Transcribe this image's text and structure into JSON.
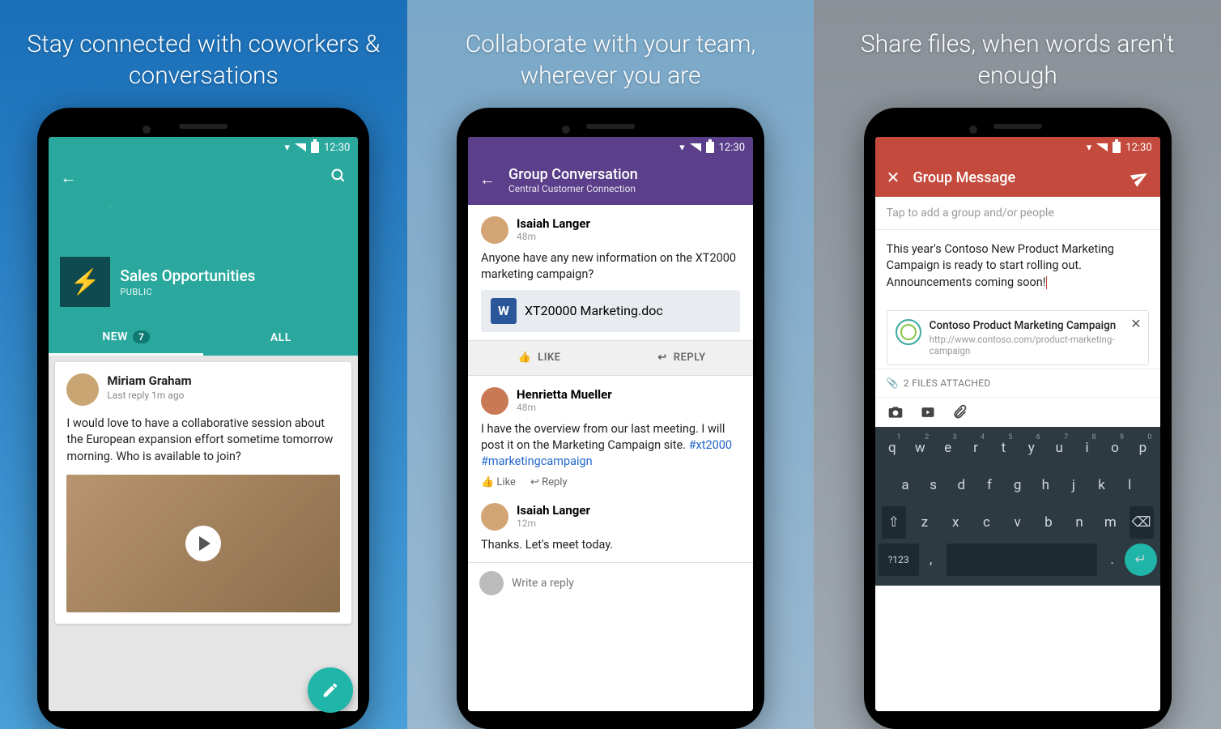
{
  "status": {
    "time": "12:30"
  },
  "panel1": {
    "headline": "Stay connected with coworkers & conversations",
    "group": {
      "name": "Sales Opportunities",
      "privacy": "PUBLIC"
    },
    "tabs": {
      "new": "NEW",
      "new_count": "7",
      "all": "ALL"
    },
    "post": {
      "author": "Miriam Graham",
      "meta": "Last reply 1m ago",
      "body": "I would love to have a collaborative session about the European expansion effort sometime tomorrow morning. Who is available to join?"
    }
  },
  "panel2": {
    "headline": "Collaborate with your team, wherever you are",
    "title": "Group Conversation",
    "subtitle": "Central Customer Connection",
    "msgs": [
      {
        "author": "Isaiah Langer",
        "time": "48m",
        "body": "Anyone have any new information on the XT2000 marketing campaign?",
        "attachment": "XT20000 Marketing.doc"
      },
      {
        "author": "Henrietta Mueller",
        "time": "48m",
        "body_plain": "I have the overview from our last meeting. I will post it on the Marketing Campaign site. ",
        "hashtags": "#xt2000 #marketingcampaign"
      },
      {
        "author": "Isaiah Langer",
        "time": "12m",
        "body": "Thanks. Let's meet today."
      }
    ],
    "actions": {
      "like": "LIKE",
      "reply": "REPLY",
      "like2": "Like",
      "reply2": "Reply"
    },
    "reply_placeholder": "Write a reply"
  },
  "panel3": {
    "headline": "Share files, when words aren't enough",
    "title": "Group Message",
    "to_placeholder": "Tap to add a group and/or people",
    "body": "This year's Contoso New Product Marketing Campaign is ready to start rolling out. Announcements coming soon!",
    "link": {
      "title": "Contoso Product Marketing Campaign",
      "url": "http://www.contoso.com/product-marketing-campaign"
    },
    "attach_label": "2 FILES ATTACHED",
    "keyboard": {
      "row1": [
        "q",
        "w",
        "e",
        "r",
        "t",
        "y",
        "u",
        "i",
        "o",
        "p"
      ],
      "nums": [
        "1",
        "2",
        "3",
        "4",
        "5",
        "6",
        "7",
        "8",
        "9",
        "0"
      ],
      "row2": [
        "a",
        "s",
        "d",
        "f",
        "g",
        "h",
        "j",
        "k",
        "l"
      ],
      "row3": [
        "z",
        "x",
        "c",
        "v",
        "b",
        "n",
        "m"
      ],
      "sym": "?123"
    }
  }
}
